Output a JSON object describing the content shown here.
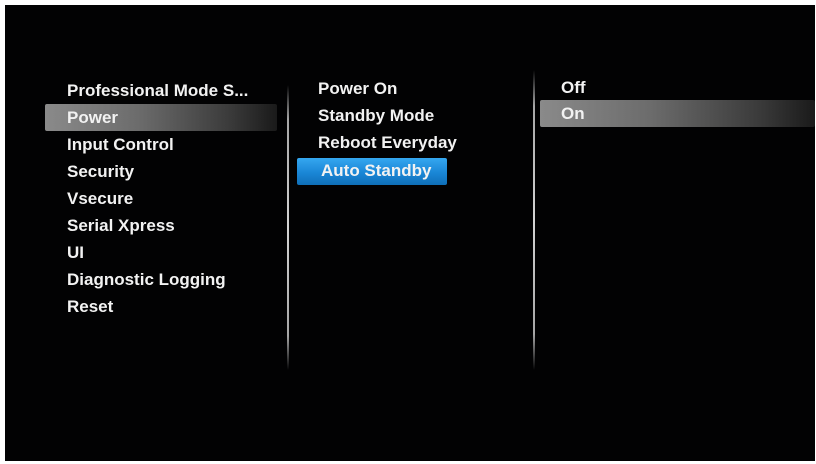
{
  "menu": {
    "categories": [
      {
        "label": "Professional Mode S..."
      },
      {
        "label": "Power"
      },
      {
        "label": "Input Control"
      },
      {
        "label": "Security"
      },
      {
        "label": "Vsecure"
      },
      {
        "label": "Serial Xpress"
      },
      {
        "label": "UI"
      },
      {
        "label": "Diagnostic Logging"
      },
      {
        "label": "Reset"
      }
    ],
    "selected_category": "Power",
    "power_options": [
      {
        "label": "Power On"
      },
      {
        "label": "Standby Mode"
      },
      {
        "label": "Reboot Everyday"
      },
      {
        "label": "Auto Standby"
      }
    ],
    "selected_option": "Auto Standby",
    "values": [
      {
        "label": "Off"
      },
      {
        "label": "On"
      }
    ],
    "selected_value": "On"
  },
  "colors": {
    "background": "#020203",
    "text": "#f2f2f2",
    "focus_highlight": "#1a86d6",
    "selection_highlight": "#7a7a7a"
  }
}
